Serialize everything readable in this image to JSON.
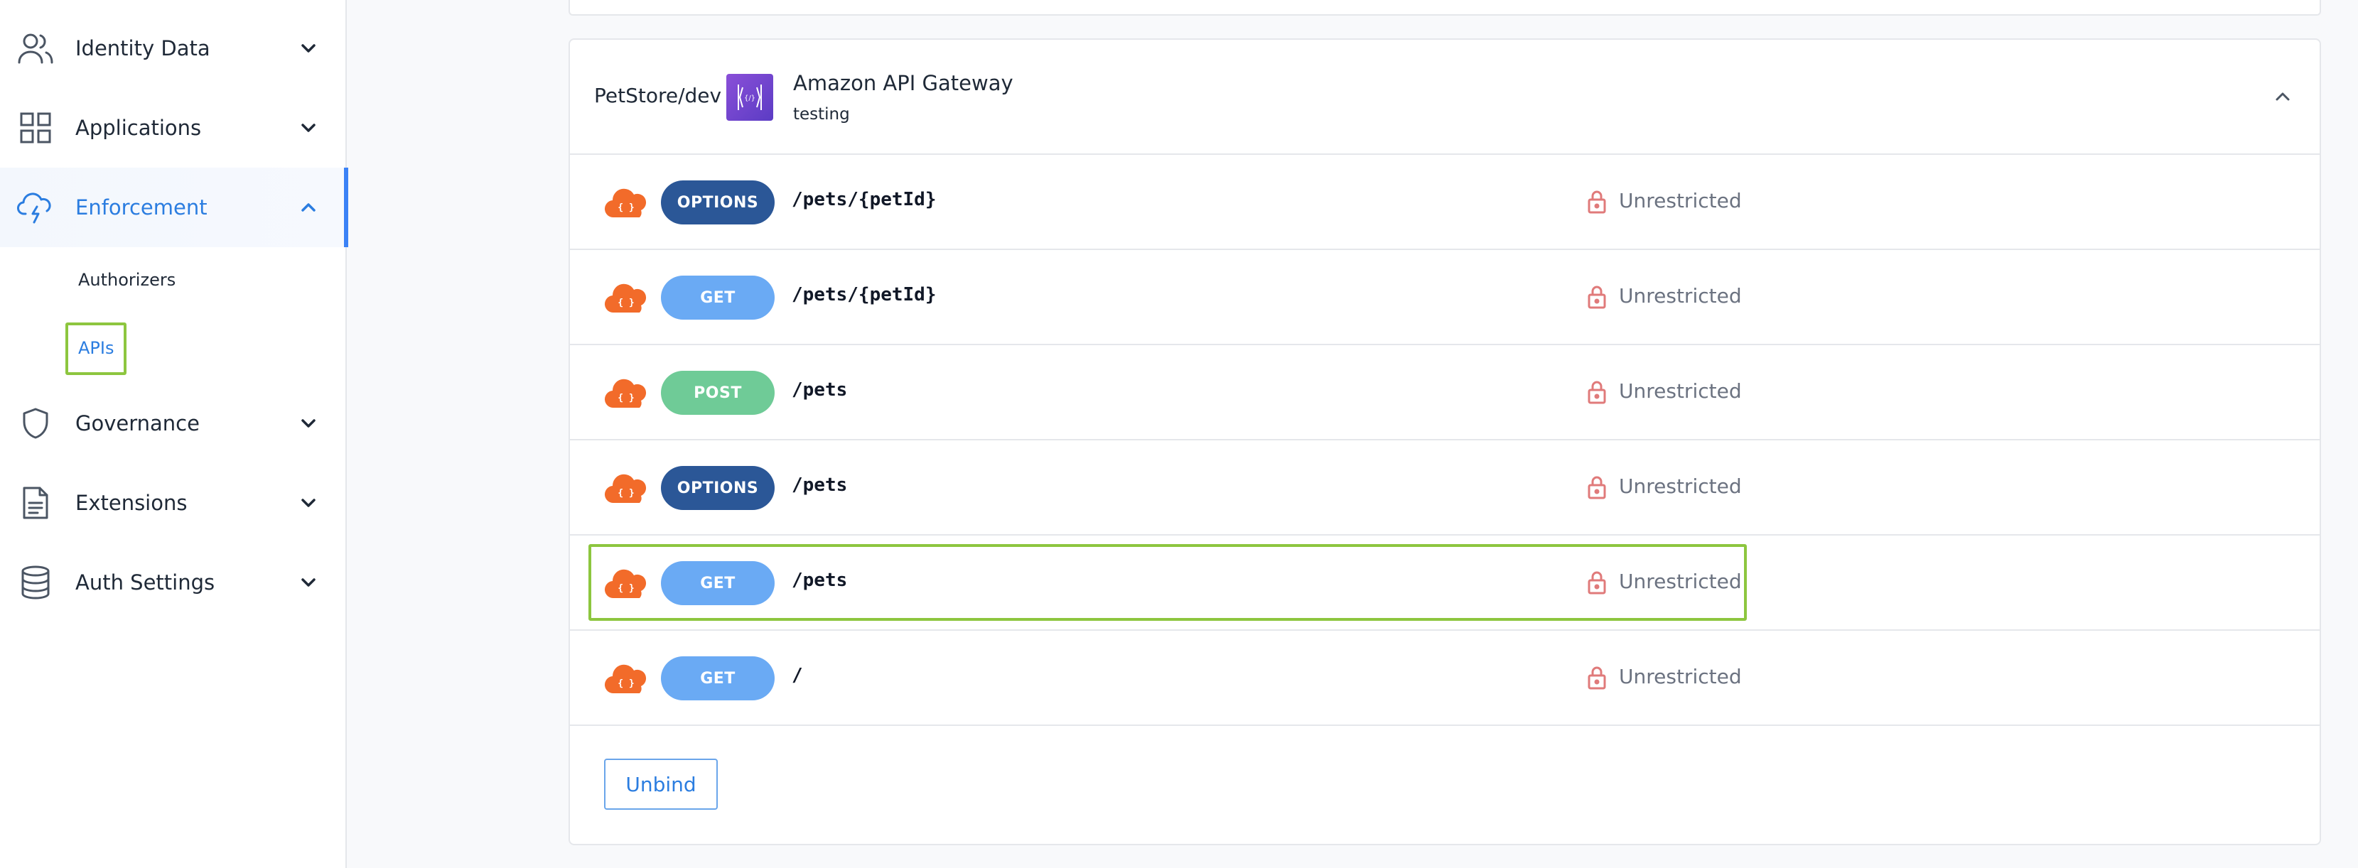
{
  "sidebar": {
    "items": [
      {
        "label": "Identity Data",
        "icon": "users-icon"
      },
      {
        "label": "Applications",
        "icon": "grid-icon"
      },
      {
        "label": "Enforcement",
        "icon": "cloud-bolt-icon",
        "active": true
      },
      {
        "label": "Governance",
        "icon": "shield-icon"
      },
      {
        "label": "Extensions",
        "icon": "document-icon"
      },
      {
        "label": "Auth Settings",
        "icon": "database-icon"
      }
    ],
    "enforcement_sub": [
      {
        "label": "Authorizers"
      },
      {
        "label": "APIs",
        "current": true
      }
    ]
  },
  "gateway": {
    "stage": "PetStore/dev",
    "title": "Amazon API Gateway",
    "subtitle": "testing",
    "icon": "api-gateway-icon",
    "expanded": true
  },
  "routes": [
    {
      "method": "OPTIONS",
      "path": "/pets/{petId}",
      "access": "Unrestricted"
    },
    {
      "method": "GET",
      "path": "/pets/{petId}",
      "access": "Unrestricted"
    },
    {
      "method": "POST",
      "path": "/pets",
      "access": "Unrestricted"
    },
    {
      "method": "OPTIONS",
      "path": "/pets",
      "access": "Unrestricted"
    },
    {
      "method": "GET",
      "path": "/pets",
      "access": "Unrestricted",
      "highlighted": true
    },
    {
      "method": "GET",
      "path": "/",
      "access": "Unrestricted"
    }
  ],
  "actions": {
    "unbind_label": "Unbind"
  },
  "colors": {
    "accent": "#2b7de0",
    "highlight": "#8dc63f",
    "options": "#2b5797",
    "get": "#6aaaf4",
    "post": "#6fcb97",
    "lock": "#e07a7a",
    "cloud": "#f26b2a"
  }
}
